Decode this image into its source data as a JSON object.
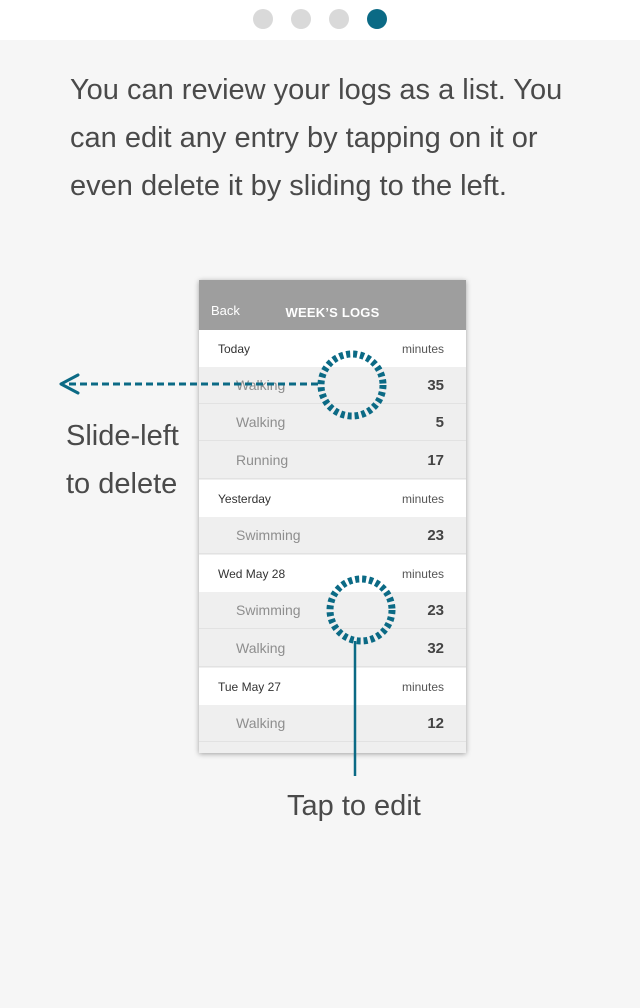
{
  "pagination": {
    "total": 4,
    "active_index": 3
  },
  "intro_text": "You can review your logs as a list. You can edit any entry by tapping on it or even delete it by sliding to the left.",
  "phone": {
    "back_label": "Back",
    "title": "WEEK’S LOGS",
    "groups": [
      {
        "date": "Today",
        "unit": "minutes",
        "entries": [
          {
            "activity": "Walking",
            "minutes": "35"
          },
          {
            "activity": "Walking",
            "minutes": "5"
          },
          {
            "activity": "Running",
            "minutes": "17"
          }
        ]
      },
      {
        "date": "Yesterday",
        "unit": "minutes",
        "entries": [
          {
            "activity": "Swimming",
            "minutes": "23"
          }
        ]
      },
      {
        "date": "Wed May 28",
        "unit": "minutes",
        "entries": [
          {
            "activity": "Swimming",
            "minutes": "23"
          },
          {
            "activity": "Walking",
            "minutes": "32"
          }
        ]
      },
      {
        "date": "Tue May 27",
        "unit": "minutes",
        "entries": [
          {
            "activity": "Walking",
            "minutes": "12"
          }
        ]
      }
    ]
  },
  "callouts": {
    "slide_line1": "Slide-left",
    "slide_line2": "to delete",
    "tap": "Tap to edit"
  },
  "colors": {
    "accent": "#0b6a85",
    "header": "#9e9e9e",
    "background": "#f6f6f6"
  }
}
